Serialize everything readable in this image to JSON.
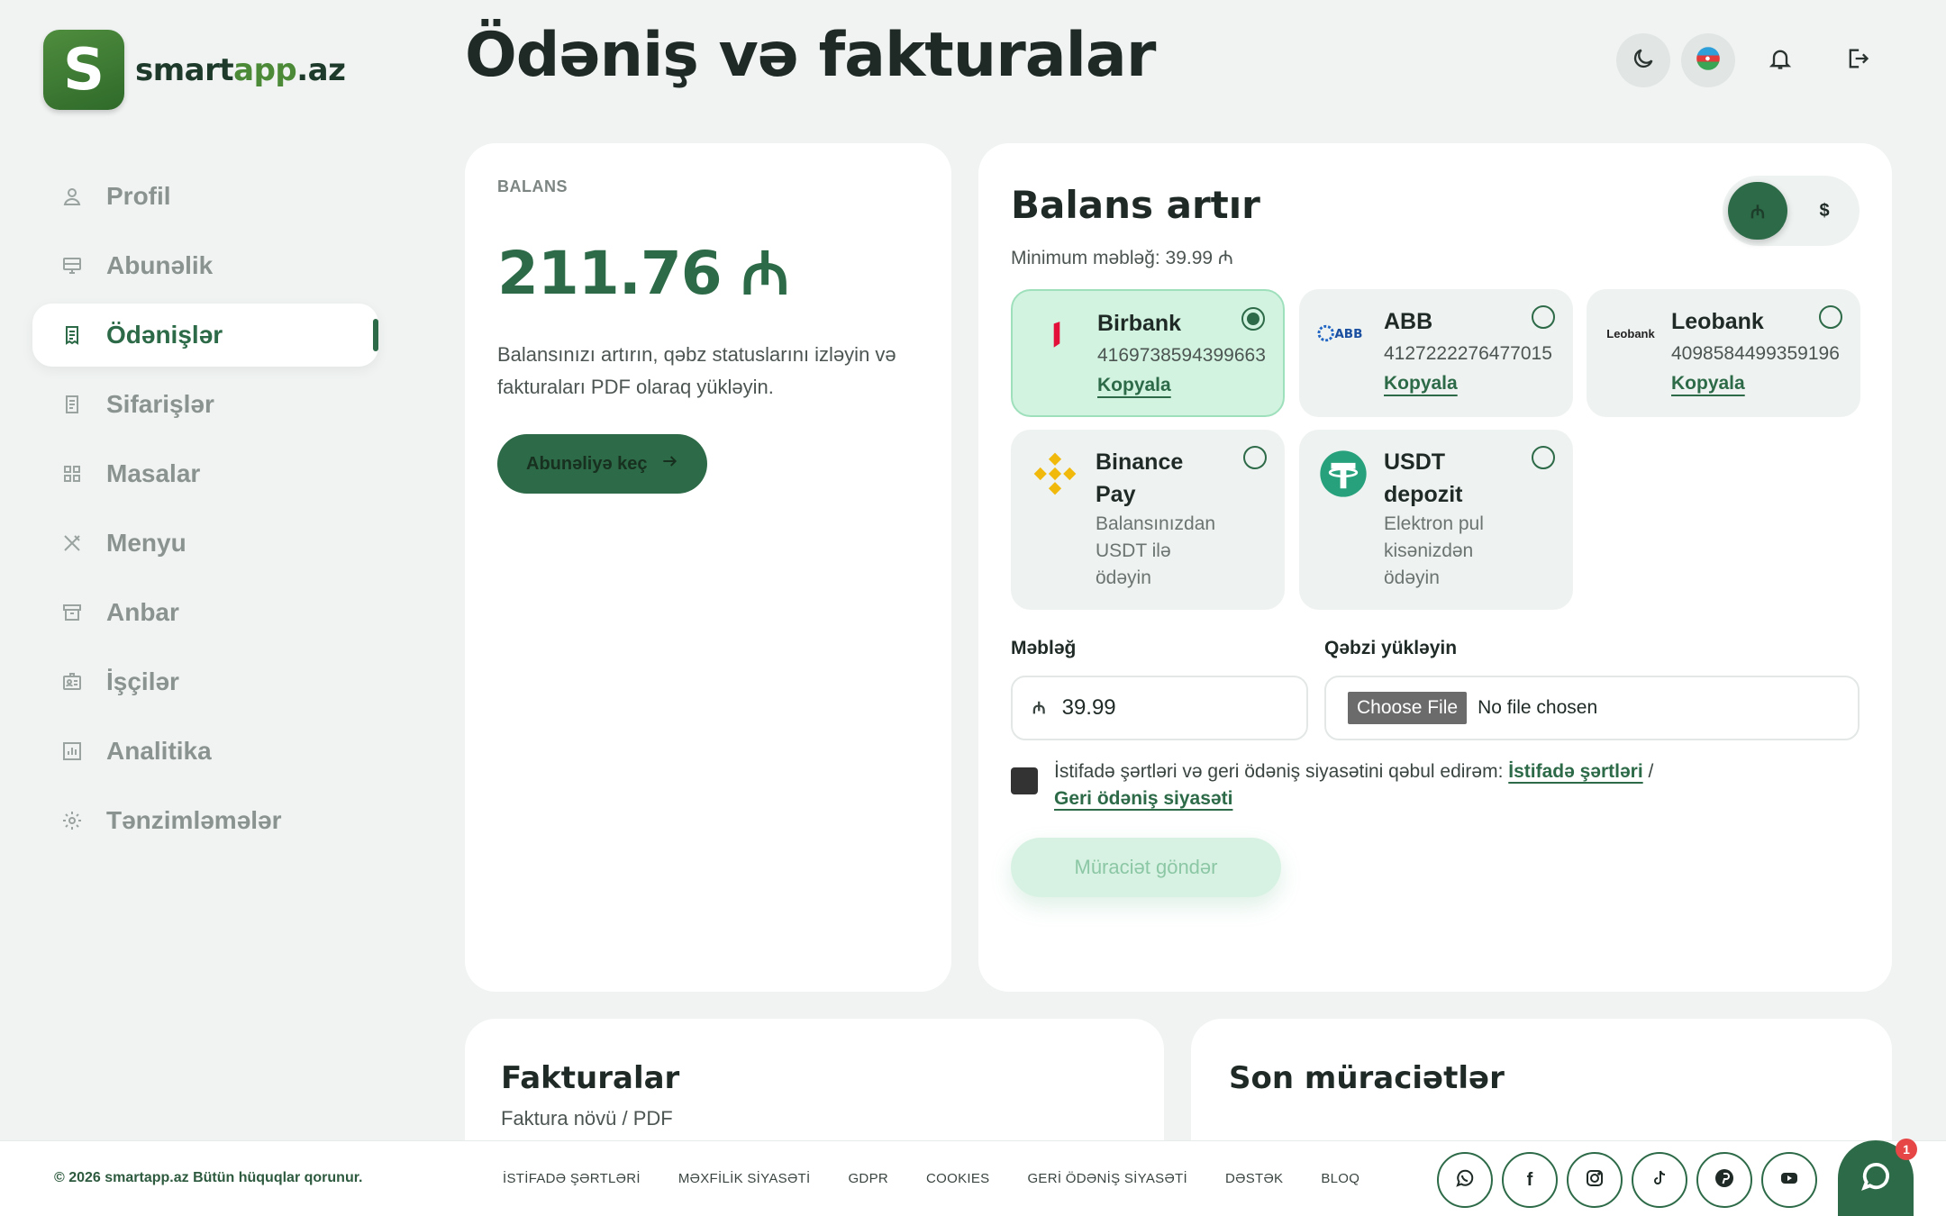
{
  "brand": {
    "name_a": "smart",
    "name_b": "app",
    "name_c": ".az",
    "logo_letter": "S"
  },
  "page": {
    "title": "Ödəniş və fakturalar"
  },
  "sidebar": {
    "items": [
      {
        "label": "Profil",
        "icon": "user-icon",
        "active": false
      },
      {
        "label": "Abunəlik",
        "icon": "monitor-icon",
        "active": false
      },
      {
        "label": "Ödənişlər",
        "icon": "receipt-icon",
        "active": true
      },
      {
        "label": "Sifarişlər",
        "icon": "order-icon",
        "active": false
      },
      {
        "label": "Masalar",
        "icon": "grid-icon",
        "active": false
      },
      {
        "label": "Menyu",
        "icon": "utensils-icon",
        "active": false
      },
      {
        "label": "Anbar",
        "icon": "archive-icon",
        "active": false
      },
      {
        "label": "İşçilər",
        "icon": "id-card-icon",
        "active": false
      },
      {
        "label": "Analitika",
        "icon": "chart-icon",
        "active": false
      },
      {
        "label": "Tənzimləmələr",
        "icon": "gear-icon",
        "active": false
      }
    ]
  },
  "header": {
    "theme_icon": "moon-icon",
    "lang_icon": "azerbaijan-flag-icon",
    "notif_icon": "bell-icon",
    "logout_icon": "logout-icon"
  },
  "balance": {
    "caption": "BALANS",
    "amount": "211.76 ₼",
    "description": "Balansınızı artırın, qəbz statuslarını izləyin və fakturaları PDF olaraq yükləyin.",
    "button_label": "Abunəliyə keç"
  },
  "topup": {
    "title": "Balans artır",
    "minimum": "Minimum məbləğ: 39.99 ₼",
    "currency_options": [
      "₼",
      "$"
    ],
    "methods": [
      {
        "name": "Birbank",
        "number": "4169738594399663",
        "copy_label": "Kopyala",
        "selected": true
      },
      {
        "name": "ABB",
        "number": "4127222276477015",
        "copy_label": "Kopyala",
        "selected": false
      },
      {
        "name": "Leobank",
        "number": "4098584499359196",
        "copy_label": "Kopyala",
        "selected": false
      },
      {
        "name_line1": "Binance",
        "name_line2": "Pay",
        "sub_lines": [
          "Balansınızdan",
          "USDT ilə",
          "ödəyin"
        ],
        "selected": false
      },
      {
        "name_line1": "USDT",
        "name_line2": "depozit",
        "sub_lines": [
          "Elektron pul",
          "kisənizdən",
          "ödəyin"
        ],
        "selected": false
      }
    ],
    "leobank_logo_text": "Leobank",
    "abb_logo_text": "ABB",
    "amount_label": "Məbləğ",
    "amount_currency": "₼",
    "amount_value": "39.99",
    "receipt_label": "Qəbzi yükləyin",
    "file_button": "Choose File",
    "file_status": "No file chosen",
    "terms_text": "İstifadə şərtləri və geri ödəniş siyasətini qəbul edirəm:",
    "terms_link": "İstifadə şərtləri",
    "terms_sep": "/",
    "refund_link": "Geri ödəniş siyasəti",
    "submit_label": "Müraciət göndər"
  },
  "invoices": {
    "title": "Fakturalar",
    "subtitle": "Faktura növü / PDF"
  },
  "recent": {
    "title": "Son müraciətlər"
  },
  "footer": {
    "copyright": "© 2026 smartapp.az Bütün hüquqlar qorunur.",
    "links": [
      "İSTİFADƏ ŞƏRTLƏRİ",
      "MƏXFİLİK SİYASƏTİ",
      "GDPR",
      "COOKIES",
      "GERİ ÖDƏNİŞ SİYASƏTİ",
      "DƏSTƏK",
      "BLOQ"
    ],
    "social": [
      "whatsapp-icon",
      "facebook-icon",
      "instagram-icon",
      "tiktok-icon",
      "pinterest-icon",
      "youtube-icon"
    ],
    "chat_badge": "1"
  },
  "colors": {
    "primary": "#2d6a48",
    "background": "#f0f3f2",
    "selected_card": "#d2f3e0"
  }
}
